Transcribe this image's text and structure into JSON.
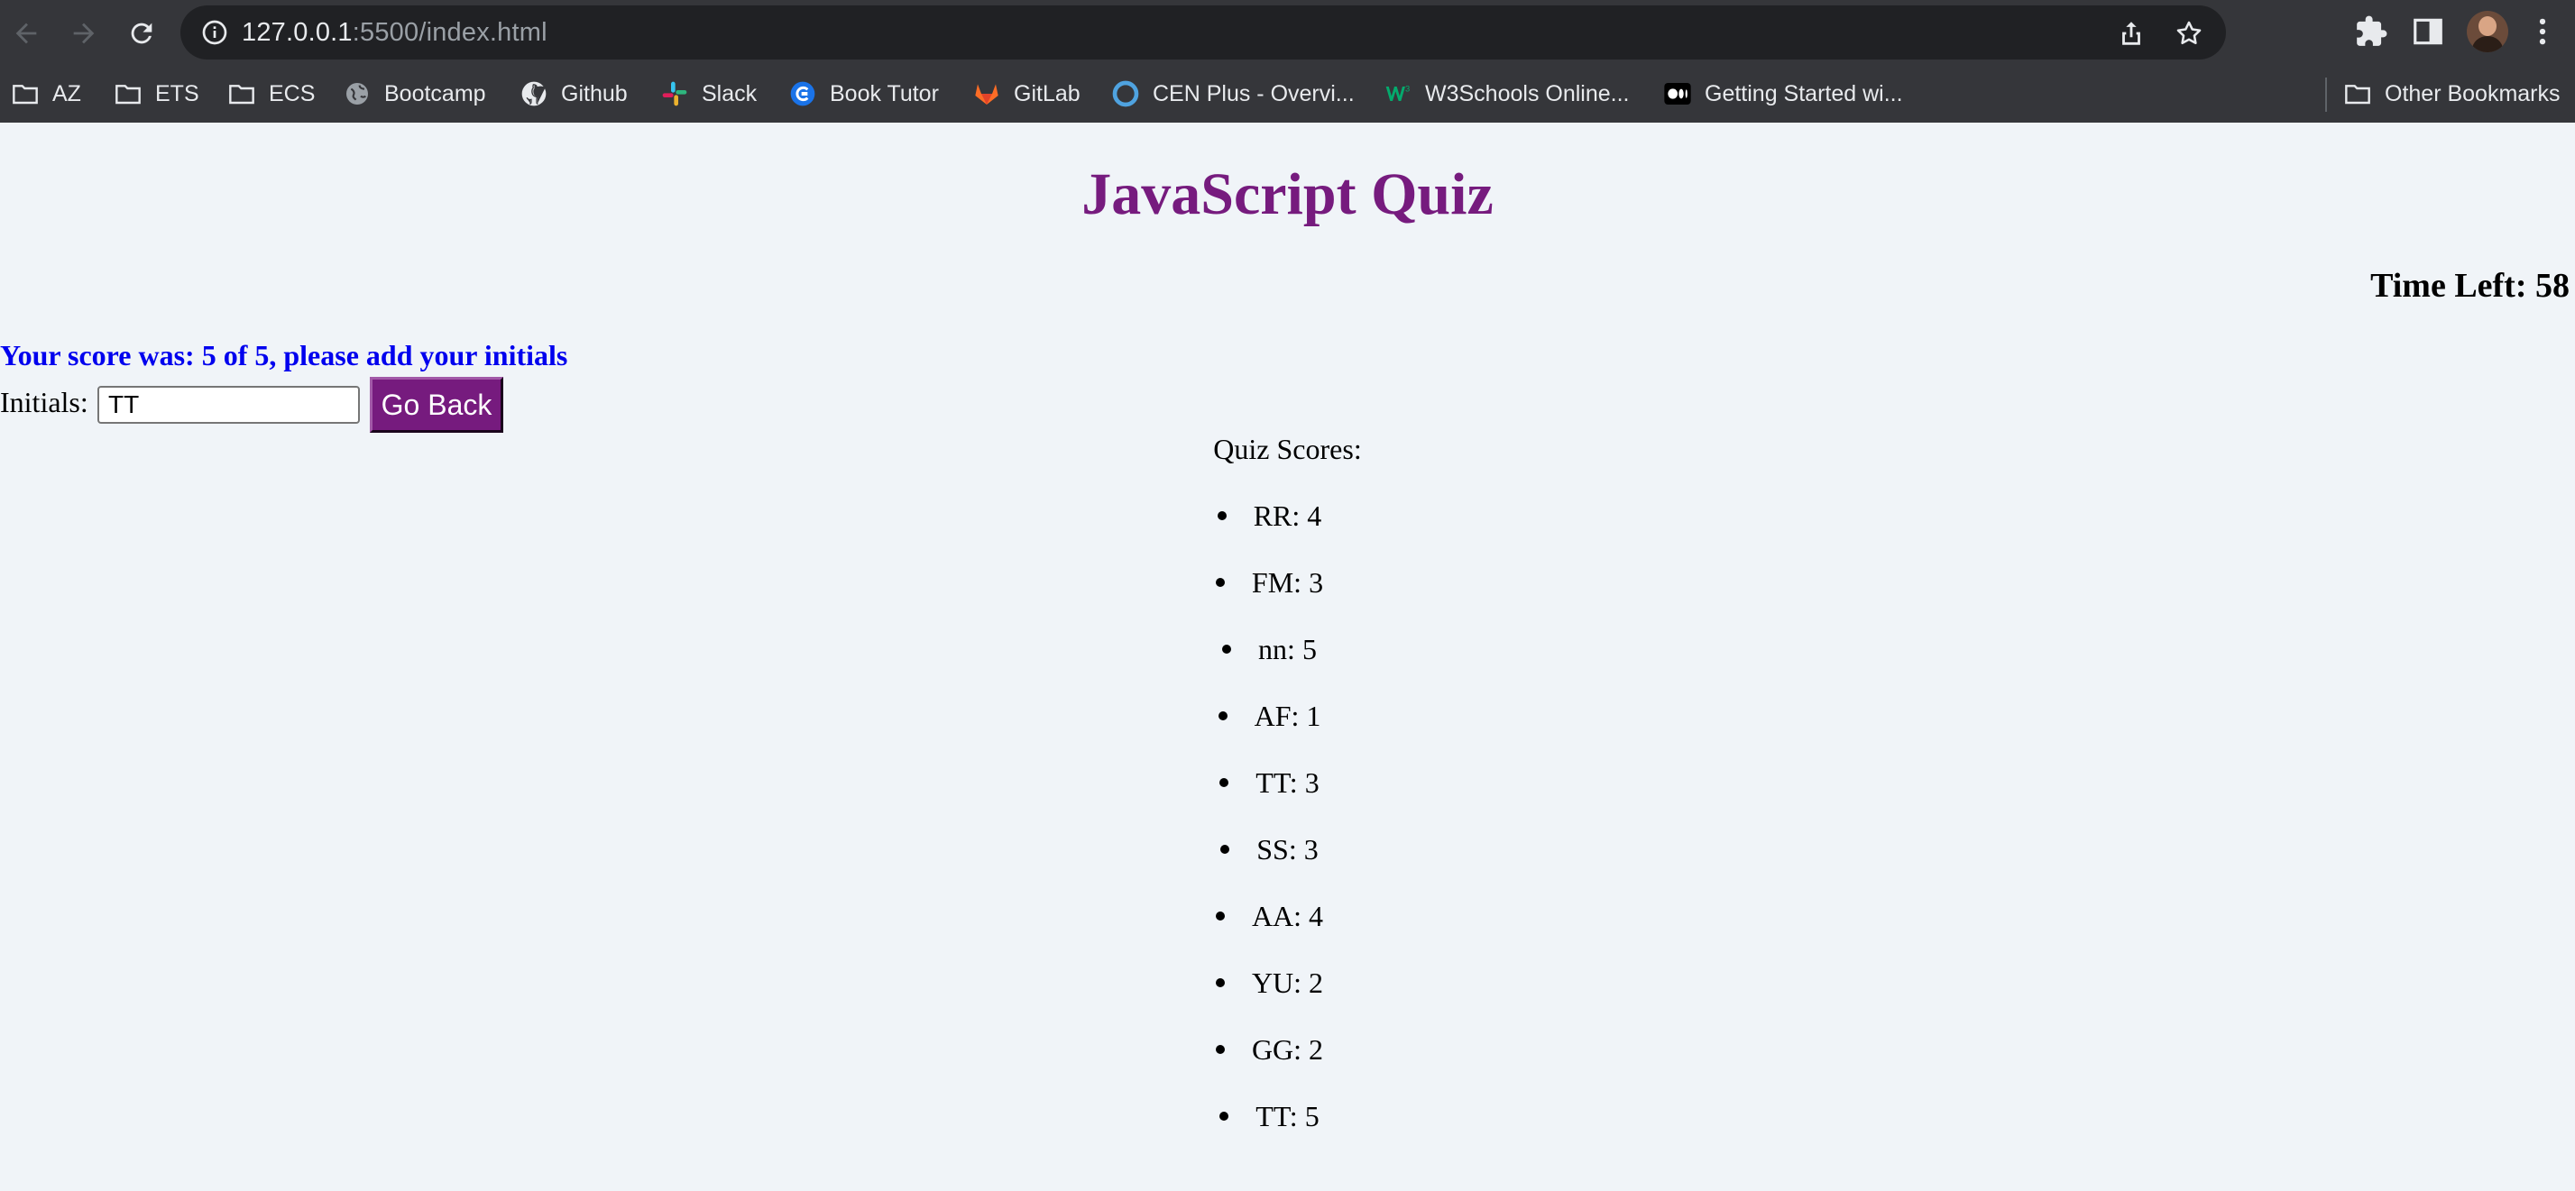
{
  "browser": {
    "url_host": "127.0.0.1",
    "url_path": ":5500/index.html",
    "bookmarks": [
      {
        "label": "AZ",
        "icon": "folder-icon"
      },
      {
        "label": "ETS",
        "icon": "folder-icon"
      },
      {
        "label": "ECS",
        "icon": "folder-icon"
      },
      {
        "label": "Bootcamp",
        "icon": "globe-icon"
      },
      {
        "label": "Github",
        "icon": "github-icon"
      },
      {
        "label": "Slack",
        "icon": "slack-icon"
      },
      {
        "label": "Book Tutor",
        "icon": "book-tutor-icon"
      },
      {
        "label": "GitLab",
        "icon": "gitlab-icon"
      },
      {
        "label": "CEN Plus - Overvi...",
        "icon": "cen-icon"
      },
      {
        "label": "W3Schools Online...",
        "icon": "w3schools-icon"
      },
      {
        "label": "Getting Started wi...",
        "icon": "medium-icon"
      }
    ],
    "other_bookmarks": "Other Bookmarks"
  },
  "page": {
    "title": "JavaScript Quiz",
    "timer": "Time Left: 58",
    "score_message": "Your score was: 5 of 5, please add your initials",
    "initials_label": "Initials:",
    "initials_value": "TT",
    "go_back_label": "Go Back",
    "scores_heading": "Quiz Scores:",
    "scores": [
      "RR: 4",
      "FM: 3",
      "nn: 5",
      "AF: 1",
      "TT: 3",
      "SS: 3",
      "AA: 4",
      "YU: 2",
      "GG: 2",
      "TT: 5"
    ]
  },
  "colors": {
    "title": "#761b7e",
    "button": "#761b7e",
    "score_message": "#0000ee",
    "page_background": "#f0f4f8"
  }
}
